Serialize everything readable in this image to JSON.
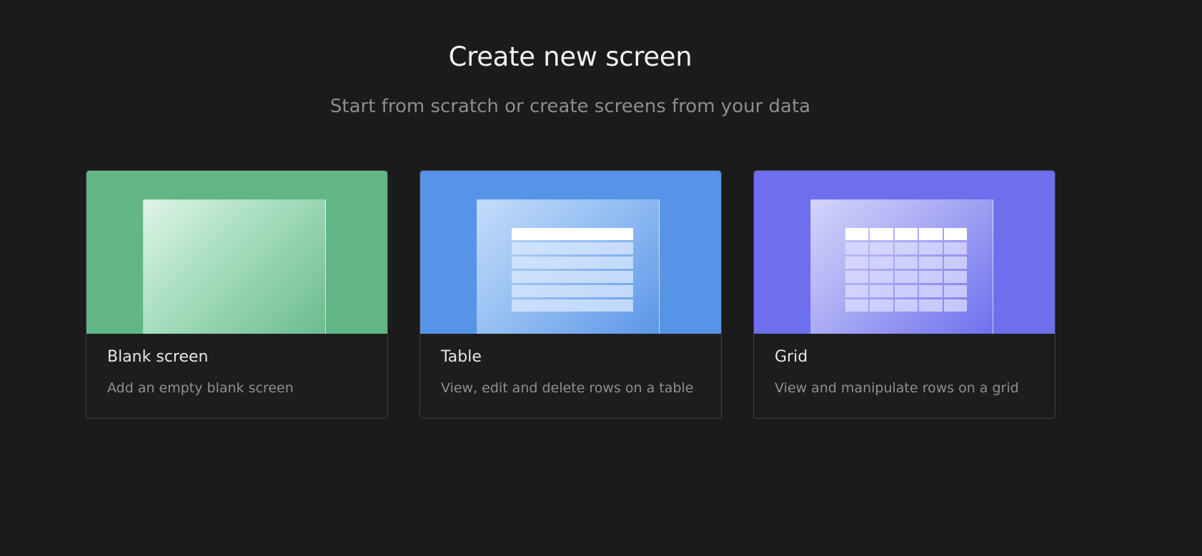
{
  "header": {
    "title": "Create new screen",
    "subtitle": "Start from scratch or create screens from your data"
  },
  "cards": [
    {
      "title": "Blank screen",
      "description": "Add an empty blank screen",
      "preview_icon": "blank-screen-icon",
      "accent_color": "#62b686"
    },
    {
      "title": "Table",
      "description": "View, edit and delete rows on a table",
      "preview_icon": "table-screen-icon",
      "accent_color": "#5794e8"
    },
    {
      "title": "Grid",
      "description": "View and manipulate rows on a grid",
      "preview_icon": "grid-screen-icon",
      "accent_color": "#6d6fed"
    }
  ],
  "colors": {
    "background": "#1b1b1b",
    "card_border": "#3e3e3e",
    "title_text": "#f2f2f2",
    "muted_text": "#8d8d8d"
  }
}
